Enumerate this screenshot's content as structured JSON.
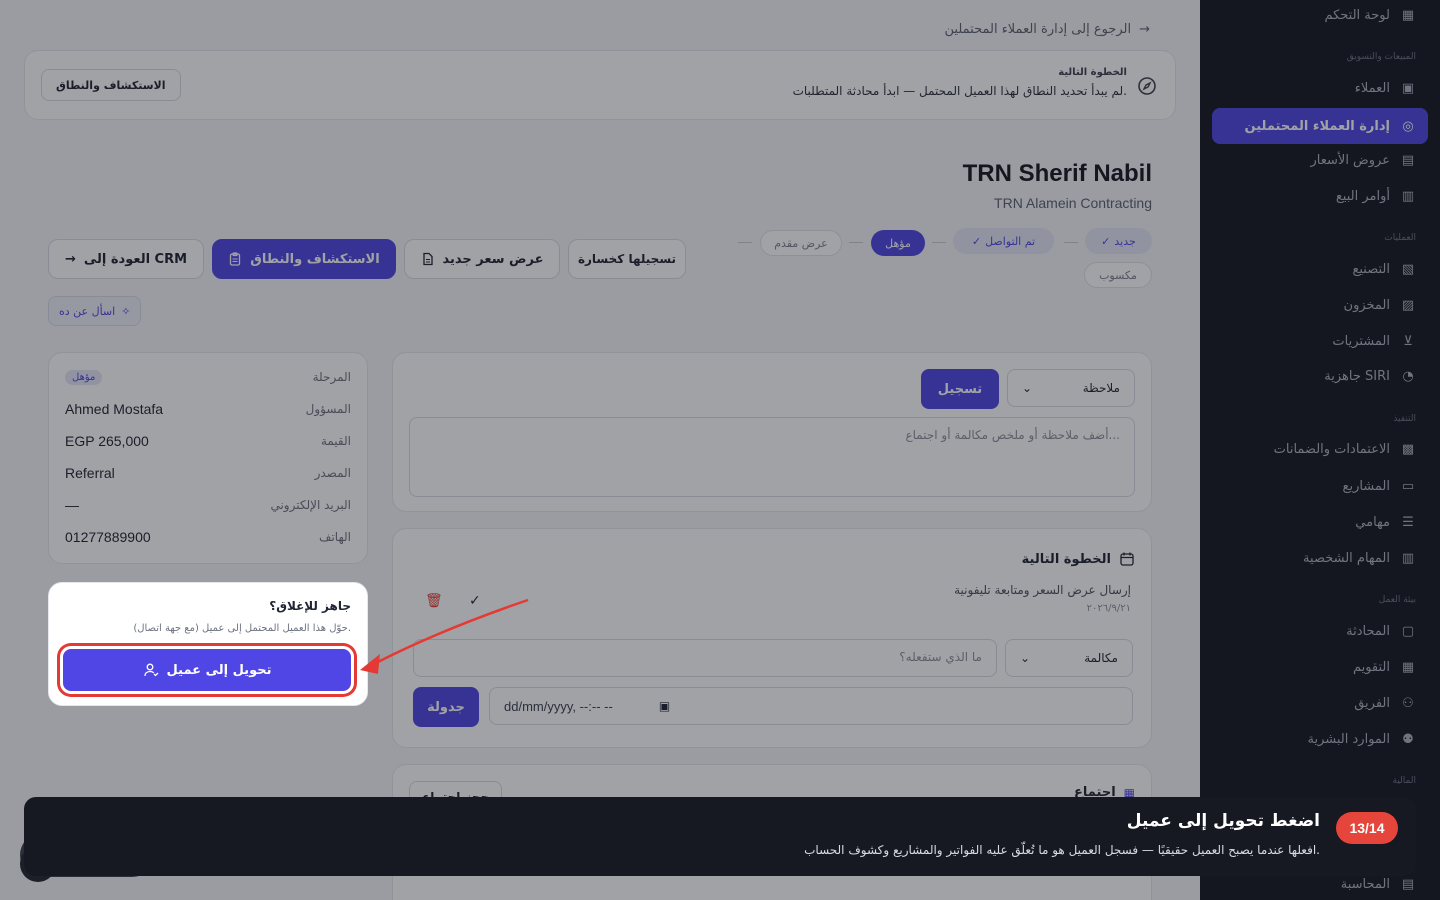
{
  "sidebar": {
    "items": [
      {
        "label": "لوحة التحكم",
        "icon": "dashboard-icon"
      },
      {
        "label": "العملاء",
        "icon": "contacts-icon"
      },
      {
        "label": "إدارة العملاء المحتملين",
        "icon": "target-icon",
        "active": true
      },
      {
        "label": "عروض الأسعار",
        "icon": "document-icon"
      },
      {
        "label": "أوامر البيع",
        "icon": "clipboard-icon"
      },
      {
        "label": "التصنيع",
        "icon": "factory-icon"
      },
      {
        "label": "المخزون",
        "icon": "warehouse-icon"
      },
      {
        "label": "المشتريات",
        "icon": "cart-icon"
      },
      {
        "label": "جاهزية SIRI",
        "icon": "gauge-icon"
      },
      {
        "label": "الاعتمادات والضمانات",
        "icon": "shield-document-icon"
      },
      {
        "label": "المشاريع",
        "icon": "folder-icon"
      },
      {
        "label": "مهامي",
        "icon": "checklist-icon"
      },
      {
        "label": "المهام الشخصية",
        "icon": "personal-tasks-icon"
      },
      {
        "label": "المحادثة",
        "icon": "chat-icon"
      },
      {
        "label": "التقويم",
        "icon": "calendar-icon"
      },
      {
        "label": "الفريق",
        "icon": "team-icon"
      },
      {
        "label": "الموارد البشرية",
        "icon": "hr-icon"
      },
      {
        "label": "المحاسبة",
        "icon": "calculator-icon"
      }
    ],
    "sections": [
      "المبيعات والتسويق",
      "العمليات",
      "التنفيذ",
      "بيئة العمل",
      "المالية"
    ]
  },
  "back_link": "الرجوع إلى إدارة العملاء المحتملين",
  "banner": {
    "title": "الخطوة التالية",
    "text": "لم يبدأ تحديد النطاق لهذا العميل المحتمل — ابدأ محادثة المتطلبات.",
    "button": "الاستكشاف والنطاق"
  },
  "lead": {
    "name": "TRN Sherif Nabil",
    "company": "TRN Alamein Contracting"
  },
  "stages": {
    "new": "جديد",
    "contacted": "تم التواصل",
    "qualified": "مؤهل",
    "proposal": "عرض مقدم",
    "won": "مكسوب"
  },
  "actions": {
    "back_crm": "العودة إلى CRM",
    "discovery": "الاستكشاف والنطاق",
    "new_quote": "عرض سعر جديد",
    "mark_lost": "تسجيلها كخسارة",
    "ask": "اسأل عن ده"
  },
  "details": {
    "stage_label": "المرحلة",
    "stage_value": "مؤهل",
    "owner_label": "المسؤول",
    "owner_value": "Ahmed Mostafa",
    "value_label": "القيمة",
    "value_value": "EGP 265,000",
    "source_label": "المصدر",
    "source_value": "Referral",
    "email_label": "البريد الإلكتروني",
    "email_value": "—",
    "phone_label": "الهاتف",
    "phone_value": "01277889900"
  },
  "ready": {
    "title": "جاهز للإغلاق؟",
    "desc": "حوّل هذا العميل المحتمل إلى عميل (مع جهة اتصال).",
    "button": "تحويل إلى عميل"
  },
  "note": {
    "type": "ملاحظة",
    "submit": "تسجيل",
    "placeholder": "أضف ملاحظة أو ملخص مكالمة أو اجتماع..."
  },
  "next_step": {
    "title": "الخطوة التالية",
    "task": "إرسال عرض السعر ومتابعة تليفونية",
    "date": "٢٠٢٦/٩/٢١",
    "type": "مكالمة",
    "placeholder": "ما الذي ستفعله؟",
    "datetime": "dd/mm/yyyy, --:-- --",
    "schedule": "جدولة"
  },
  "meeting": {
    "title": "اجتماع",
    "book": "حجز اجتماع"
  },
  "tour": {
    "step": "13/14",
    "title": "اضغط تحويل إلى عميل",
    "desc": "افعلها عندما يصبح العميل حقيقيًا — فسجل العميل هو ما تُعلّق عليه الفواتير والمشاريع وكشوف الحساب."
  },
  "colors": {
    "accent": "#4f46e5",
    "sidebar_bg": "#151821",
    "highlight": "#e53935",
    "tour_badge": "#e5453a"
  }
}
